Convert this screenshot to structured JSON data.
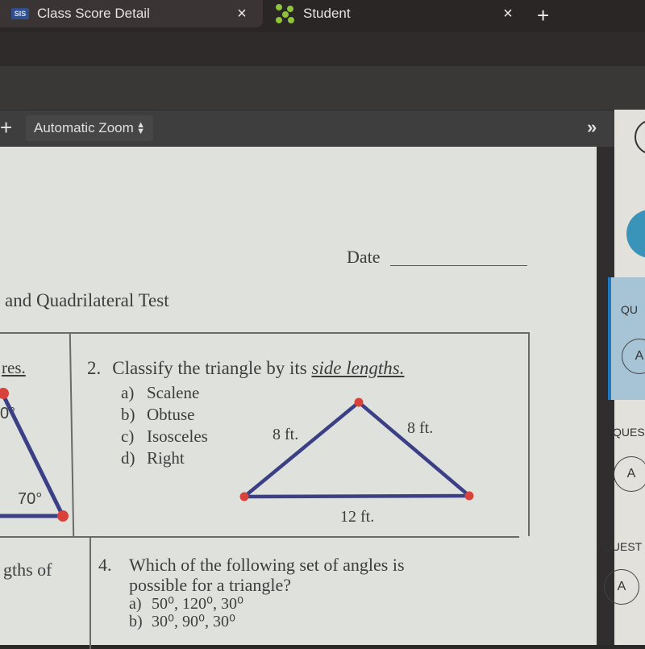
{
  "browser": {
    "tabs": [
      {
        "label": "Class Score Detail",
        "icon": "sis-icon",
        "icon_text": "SIS",
        "close": "×",
        "active": true
      },
      {
        "label": "Student",
        "icon": "student-icon",
        "close": "×",
        "active": false
      }
    ],
    "new_tab": "+"
  },
  "pdf_toolbar": {
    "zoom_in": "+",
    "zoom_select": "Automatic Zoom",
    "zoom_arrows_up": "▲",
    "zoom_arrows_down": "▼",
    "sidebar_toggle": "»"
  },
  "document": {
    "date_label": "Date",
    "title_fragment": "and Quadrilateral Test",
    "q1": {
      "fragment": "res.",
      "angle_fragment": "0°",
      "angle_label": "70°"
    },
    "q2": {
      "number": "2.",
      "stem": "Classify the triangle by its ",
      "stem_emphasis": "side lengths.",
      "options": [
        {
          "letter": "a)",
          "text": "Scalene"
        },
        {
          "letter": "b)",
          "text": "Obtuse"
        },
        {
          "letter": "c)",
          "text": "Isosceles"
        },
        {
          "letter": "d)",
          "text": "Right"
        }
      ],
      "triangle": {
        "left_side": "8 ft.",
        "right_side": "8 ft.",
        "base": "12 ft."
      }
    },
    "q3": {
      "fragment": "gths of"
    },
    "q4": {
      "number": "4.",
      "stem_line1": "Which of the following set of angles is",
      "stem_line2": "possible for a triangle?",
      "options": [
        {
          "letter": "a)",
          "text": "50⁰, 120⁰, 30⁰"
        },
        {
          "letter": "b)",
          "text": "30⁰, 90⁰, 30⁰"
        }
      ]
    }
  },
  "side_panel": {
    "questions": [
      {
        "label": "QU",
        "answer": "A",
        "active": true
      },
      {
        "label": "QUES",
        "answer": "A",
        "active": false
      },
      {
        "label": "QUEST",
        "answer": "A",
        "active": false
      }
    ]
  },
  "colors": {
    "triangle_stroke": "#3b3f86",
    "vertex_fill": "#d9423a",
    "active_question_bg": "#a7c3d6",
    "active_question_border": "#1f78c0",
    "accent_circle": "#3a93b8"
  }
}
